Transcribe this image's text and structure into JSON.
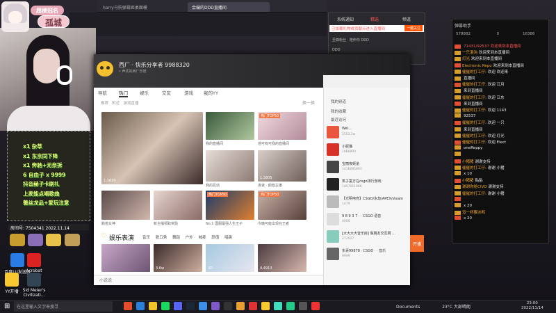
{
  "avatar_labels": {
    "top": "屈楼冠名",
    "name": "孤城"
  },
  "browser": {
    "tabs": [
      {
        "label": "harry马驹弹幕姬桌面模"
      },
      {
        "label": "会编的DDD直播间"
      }
    ]
  },
  "gift_list": [
    "x1 杂草",
    "x1 东京同下降",
    "x1 奔驰+无奈拆",
    "6 自由子 x 9999",
    "抖音赫子卡刷礼",
    "上麦能点唱歌曲",
    "蕾丝龙品+爱玩注意"
  ],
  "room_info": {
    "id": "房间号: 7504341",
    "date": "2022.11.14"
  },
  "desktop_shortcuts": [
    {
      "label": "百度LU发送器"
    },
    {
      "label": "Acrobat Reader"
    },
    {
      "label": "YY开播"
    },
    {
      "label": "Sid Meier's Civilizati..."
    }
  ],
  "music_player": {
    "station": "西厂 · 快乐分享者 9988320",
    "substation": "• 声优的西厂乐谱",
    "nav_tabs": [
      "导航",
      "热门",
      "娱乐",
      "交友",
      "游戏",
      "我的YY"
    ],
    "subnav": [
      "推荐",
      "附近",
      "游戏直播"
    ],
    "refresh": "换一换",
    "cards": [
      {
        "badge": "",
        "count": "1.1620",
        "caption": ""
      },
      {
        "badge": "",
        "count": "",
        "caption": "我的直播间"
      },
      {
        "badge": "热门TOP50",
        "count": "",
        "caption": "他可有可我的直播间"
      },
      {
        "badge": "",
        "count": "",
        "caption": "我的互动"
      },
      {
        "badge": "",
        "count": "1.3805",
        "caption": "诶诶 · 颜值主播"
      },
      {
        "badge": "",
        "count": "",
        "caption": "新主播领取奖励"
      },
      {
        "badge": "",
        "count": "",
        "caption": "颜值女神"
      },
      {
        "badge": "热门TOP50",
        "count": "",
        "caption": "No.1 国服最强人生王子"
      },
      {
        "badge": "热门TOP50",
        "count": "",
        "caption": "今晚可能出现在王者"
      }
    ],
    "section_title": "娱乐表演",
    "section_tabs": [
      "音乐",
      "脱口秀",
      "舞蹈",
      "户外",
      "喊麦",
      "颜值",
      "唱跳"
    ],
    "bottom_cards": [
      {
        "count": ""
      },
      {
        "count": "3.6w"
      },
      {
        "count": "3D"
      },
      {
        "count": "4.4913"
      }
    ],
    "recommend_links": [
      "我的频道",
      "我的收藏",
      "最近访问"
    ],
    "recommend": [
      {
        "name": "Wel...",
        "id": "2552.2w",
        "color": "#e9573f"
      },
      {
        "name": "小屁猫",
        "id": "1986800",
        "color": "#d7322a"
      },
      {
        "name": "宝丽夜频道",
        "id": "1416095893",
        "color": "#444"
      },
      {
        "name": "笑子童方在csgo排行游戏",
        "id": "1457011666",
        "color": "#222"
      },
      {
        "name": "【光明电竞】CSGO/永劫/APEX/steam",
        "id": "1479",
        "color": "#bbb"
      },
      {
        "name": "9 8 9 3 7 · · CSGO 语音",
        "id": "4000",
        "color": "#ddd"
      },
      {
        "name": "[大大大大音乐房] 做朋友交互网 ...",
        "id": "272027",
        "color": "#8cb"
      },
      {
        "name": "东哥99878 · CSGO · · 音乐",
        "id": "9999",
        "color": "#666"
      }
    ],
    "search_placeholder": "小说说",
    "live_button": "开播"
  },
  "yy_popup": {
    "tabs": [
      "系统通知",
      "精选",
      "频道"
    ],
    "notice": "已加载礼物或贡献点进入直播间",
    "follow": "一键关注",
    "users": [
      {
        "name": "至尊粉丝 · 陪伴你 DDD"
      },
      {
        "name": "DDD"
      }
    ]
  },
  "chat": {
    "title": "弹幕助手",
    "stats": [
      "578882",
      "0",
      "16386"
    ],
    "lines": [
      {
        "type": "sys",
        "user": "",
        "msg": "71431/92537 欢迎来到本直播间"
      },
      {
        "type": "chat",
        "user": "一只混沌",
        "msg": "欢迎来到本直播间"
      },
      {
        "type": "chat",
        "user": "灯光",
        "msg": "欢迎来到本直播间"
      },
      {
        "type": "chat",
        "user": "Electronic Repo",
        "msg": "欢迎来到本直播间"
      },
      {
        "type": "chat",
        "user": "催催的打工仔:",
        "msg": "欢迎 欢迎来"
      },
      {
        "type": "chat",
        "user": "",
        "msg": "直播间"
      },
      {
        "type": "chat",
        "user": "催催的打工仔:",
        "msg": "欢迎 江月"
      },
      {
        "type": "chat",
        "user": "",
        "msg": "来到直播间"
      },
      {
        "type": "chat",
        "user": "催催的打工仔:",
        "msg": "欢迎 江东"
      },
      {
        "type": "chat",
        "user": "",
        "msg": "来到直播间"
      },
      {
        "type": "chat",
        "user": "催催的打工仔:",
        "msg": "欢迎 1143"
      },
      {
        "type": "chat",
        "user": "",
        "msg": "92537"
      },
      {
        "type": "chat",
        "user": "催催的打工仔:",
        "msg": "欢迎 一只"
      },
      {
        "type": "chat",
        "user": "",
        "msg": "来到直播间"
      },
      {
        "type": "chat",
        "user": "催催的打工仔:",
        "msg": "欢迎 灯光"
      },
      {
        "type": "chat",
        "user": "催催的打工仔:",
        "msg": "欢迎 Elect"
      },
      {
        "type": "chat",
        "user": "",
        "msg": "oneReppy"
      },
      {
        "type": "chat",
        "user": "",
        "msg": ""
      },
      {
        "type": "chat",
        "user": "小猪猪",
        "msg": "谢谢支持"
      },
      {
        "type": "chat",
        "user": "催催的打工仔:",
        "msg": "谢谢 小猪"
      },
      {
        "type": "chat",
        "user": "",
        "msg": "x 10"
      },
      {
        "type": "chat",
        "user": "小猪猪",
        "msg": "贴贴"
      },
      {
        "type": "chat",
        "user": "谢谢你给CIVO",
        "msg": "谢谢支持"
      },
      {
        "type": "chat",
        "user": "催催的打工仔:",
        "msg": "谢谢 小猪"
      },
      {
        "type": "chat",
        "user": "",
        "msg": ""
      },
      {
        "type": "chat",
        "user": "",
        "msg": "x 20"
      },
      {
        "type": "chat",
        "user": "没一杯要冰鸭",
        "msg": ""
      },
      {
        "type": "chat",
        "user": "",
        "msg": "x 20"
      }
    ]
  },
  "taskbar": {
    "search_placeholder": "在这里输入文字来搜寻",
    "tray_label": "Documents",
    "weather": "23°C 大部晴朗",
    "time": "23:00",
    "date": "2022/11/14"
  }
}
